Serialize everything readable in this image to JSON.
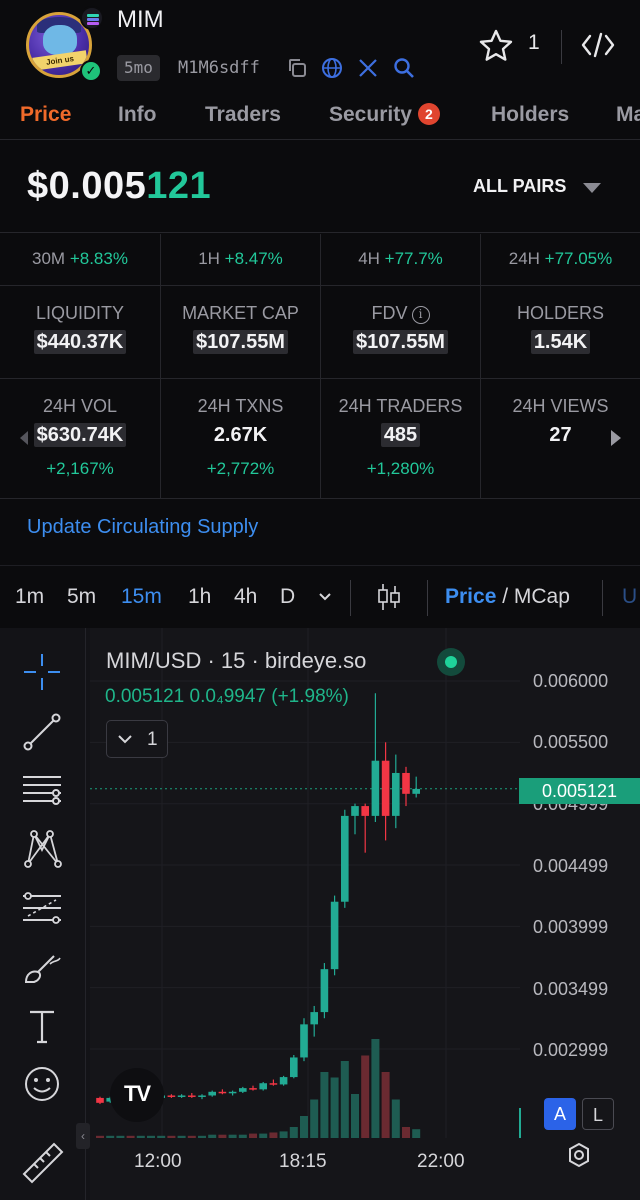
{
  "header": {
    "token_name": "MIM",
    "avatar_text": "Join us",
    "age": "5mo",
    "address": "M1M6sdff",
    "favorite_count": "1",
    "icons": [
      "copy-icon",
      "globe-icon",
      "x-icon",
      "search-icon",
      "star-icon",
      "code-icon"
    ]
  },
  "tabs": [
    {
      "label": "Price",
      "active": true
    },
    {
      "label": "Info"
    },
    {
      "label": "Traders"
    },
    {
      "label": "Security",
      "badge": "2"
    },
    {
      "label": "Holders"
    },
    {
      "label": "Ma"
    }
  ],
  "price": {
    "prefix": "$0.005",
    "highlight": "121",
    "pairs_label": "ALL PAIRS"
  },
  "performance": [
    {
      "period": "30M",
      "change": "+8.83%"
    },
    {
      "period": "1H",
      "change": "+8.47%"
    },
    {
      "period": "4H",
      "change": "+77.7%"
    },
    {
      "period": "24H",
      "change": "+77.05%"
    }
  ],
  "stats_row1": [
    {
      "label": "LIQUIDITY",
      "value": "$440.37K"
    },
    {
      "label": "MARKET CAP",
      "value": "$107.55M"
    },
    {
      "label": "FDV",
      "value": "$107.55M",
      "info_icon": "i"
    },
    {
      "label": "HOLDERS",
      "value": "1.54K"
    }
  ],
  "stats_row2": [
    {
      "label": "24H VOL",
      "value": "$630.74K",
      "change": "+2,167%"
    },
    {
      "label": "24H TXNS",
      "value": "2.67K",
      "change": "+2,772%"
    },
    {
      "label": "24H TRADERS",
      "value": "485",
      "change": "+1,280%"
    },
    {
      "label": "24H VIEWS",
      "value": "27",
      "change": ""
    }
  ],
  "update_link": "Update Circulating Supply",
  "toolbar": {
    "timeframes": [
      {
        "label": "1m"
      },
      {
        "label": "5m"
      },
      {
        "label": "15m",
        "active": true
      },
      {
        "label": "1h"
      },
      {
        "label": "4h"
      },
      {
        "label": "D"
      }
    ],
    "price_label": "Price",
    "mcap_label": " / MCap",
    "next_fragment": "U"
  },
  "chart": {
    "title": "MIM/USD · 15 · birdeye.so",
    "ohlc_text": "0.005121  0.0₄9947 (+1.98%)",
    "indicator_count": "1",
    "current_price_label": "0.005121",
    "y_ticks": [
      "0.006000",
      "0.005500",
      "0.004999",
      "0.004499",
      "0.003999",
      "0.003499",
      "0.002999"
    ],
    "x_ticks": [
      "12:00",
      "18:15",
      "22:00"
    ],
    "logo_text": "TV",
    "scale_buttons": [
      "A",
      "L"
    ],
    "colors": {
      "up": "#22ab94",
      "down": "#f23645",
      "accent": "#3d8ef0",
      "brand": "#f06a2a"
    }
  },
  "chart_data": {
    "type": "candlestick",
    "title": "MIM/USD · 15 · birdeye.so",
    "x_ticks": [
      "12:00",
      "18:15",
      "22:00"
    ],
    "ylim": [
      0.00255,
      0.00615
    ],
    "current_price": 0.005121,
    "candles": [
      {
        "o": 0.0026,
        "h": 0.00261,
        "l": 0.00255,
        "c": 0.00256
      },
      {
        "o": 0.00257,
        "h": 0.00261,
        "l": 0.00256,
        "c": 0.0026
      },
      {
        "o": 0.0026,
        "h": 0.00262,
        "l": 0.00259,
        "c": 0.00261
      },
      {
        "o": 0.00261,
        "h": 0.00262,
        "l": 0.00257,
        "c": 0.00258
      },
      {
        "o": 0.00258,
        "h": 0.0026,
        "l": 0.00256,
        "c": 0.00259
      },
      {
        "o": 0.00259,
        "h": 0.00261,
        "l": 0.00258,
        "c": 0.0026
      },
      {
        "o": 0.0026,
        "h": 0.00263,
        "l": 0.00259,
        "c": 0.00262
      },
      {
        "o": 0.00262,
        "h": 0.00263,
        "l": 0.0026,
        "c": 0.00261
      },
      {
        "o": 0.00261,
        "h": 0.00263,
        "l": 0.0026,
        "c": 0.00262
      },
      {
        "o": 0.00262,
        "h": 0.00264,
        "l": 0.0026,
        "c": 0.00261
      },
      {
        "o": 0.00261,
        "h": 0.00263,
        "l": 0.00259,
        "c": 0.00262
      },
      {
        "o": 0.00262,
        "h": 0.00266,
        "l": 0.00261,
        "c": 0.00265
      },
      {
        "o": 0.00265,
        "h": 0.00267,
        "l": 0.00263,
        "c": 0.00264
      },
      {
        "o": 0.00264,
        "h": 0.00266,
        "l": 0.00262,
        "c": 0.00265
      },
      {
        "o": 0.00265,
        "h": 0.00269,
        "l": 0.00264,
        "c": 0.00268
      },
      {
        "o": 0.00268,
        "h": 0.0027,
        "l": 0.00266,
        "c": 0.00267
      },
      {
        "o": 0.00267,
        "h": 0.00273,
        "l": 0.00266,
        "c": 0.00272
      },
      {
        "o": 0.00272,
        "h": 0.00275,
        "l": 0.0027,
        "c": 0.00271
      },
      {
        "o": 0.00271,
        "h": 0.00278,
        "l": 0.0027,
        "c": 0.00277
      },
      {
        "o": 0.00277,
        "h": 0.00295,
        "l": 0.00276,
        "c": 0.00293
      },
      {
        "o": 0.00293,
        "h": 0.00325,
        "l": 0.0029,
        "c": 0.0032
      },
      {
        "o": 0.0032,
        "h": 0.00335,
        "l": 0.0031,
        "c": 0.0033
      },
      {
        "o": 0.0033,
        "h": 0.0037,
        "l": 0.00325,
        "c": 0.00365
      },
      {
        "o": 0.00365,
        "h": 0.00425,
        "l": 0.0036,
        "c": 0.0042
      },
      {
        "o": 0.0042,
        "h": 0.00495,
        "l": 0.00415,
        "c": 0.0049
      },
      {
        "o": 0.0049,
        "h": 0.005,
        "l": 0.00475,
        "c": 0.00498
      },
      {
        "o": 0.00498,
        "h": 0.005,
        "l": 0.0046,
        "c": 0.0049
      },
      {
        "o": 0.0049,
        "h": 0.0059,
        "l": 0.00485,
        "c": 0.00535
      },
      {
        "o": 0.00535,
        "h": 0.0055,
        "l": 0.0047,
        "c": 0.0049
      },
      {
        "o": 0.0049,
        "h": 0.0054,
        "l": 0.0048,
        "c": 0.00525
      },
      {
        "o": 0.00525,
        "h": 0.0053,
        "l": 0.00498,
        "c": 0.00508
      },
      {
        "o": 0.00508,
        "h": 0.00522,
        "l": 0.00505,
        "c": 0.00512
      }
    ],
    "volume": [
      0.02,
      0.02,
      0.02,
      0.02,
      0.02,
      0.02,
      0.02,
      0.02,
      0.02,
      0.02,
      0.02,
      0.03,
      0.03,
      0.03,
      0.03,
      0.04,
      0.04,
      0.05,
      0.06,
      0.1,
      0.2,
      0.35,
      0.6,
      0.55,
      0.7,
      0.4,
      0.75,
      0.9,
      0.6,
      0.35,
      0.1,
      0.08
    ]
  }
}
